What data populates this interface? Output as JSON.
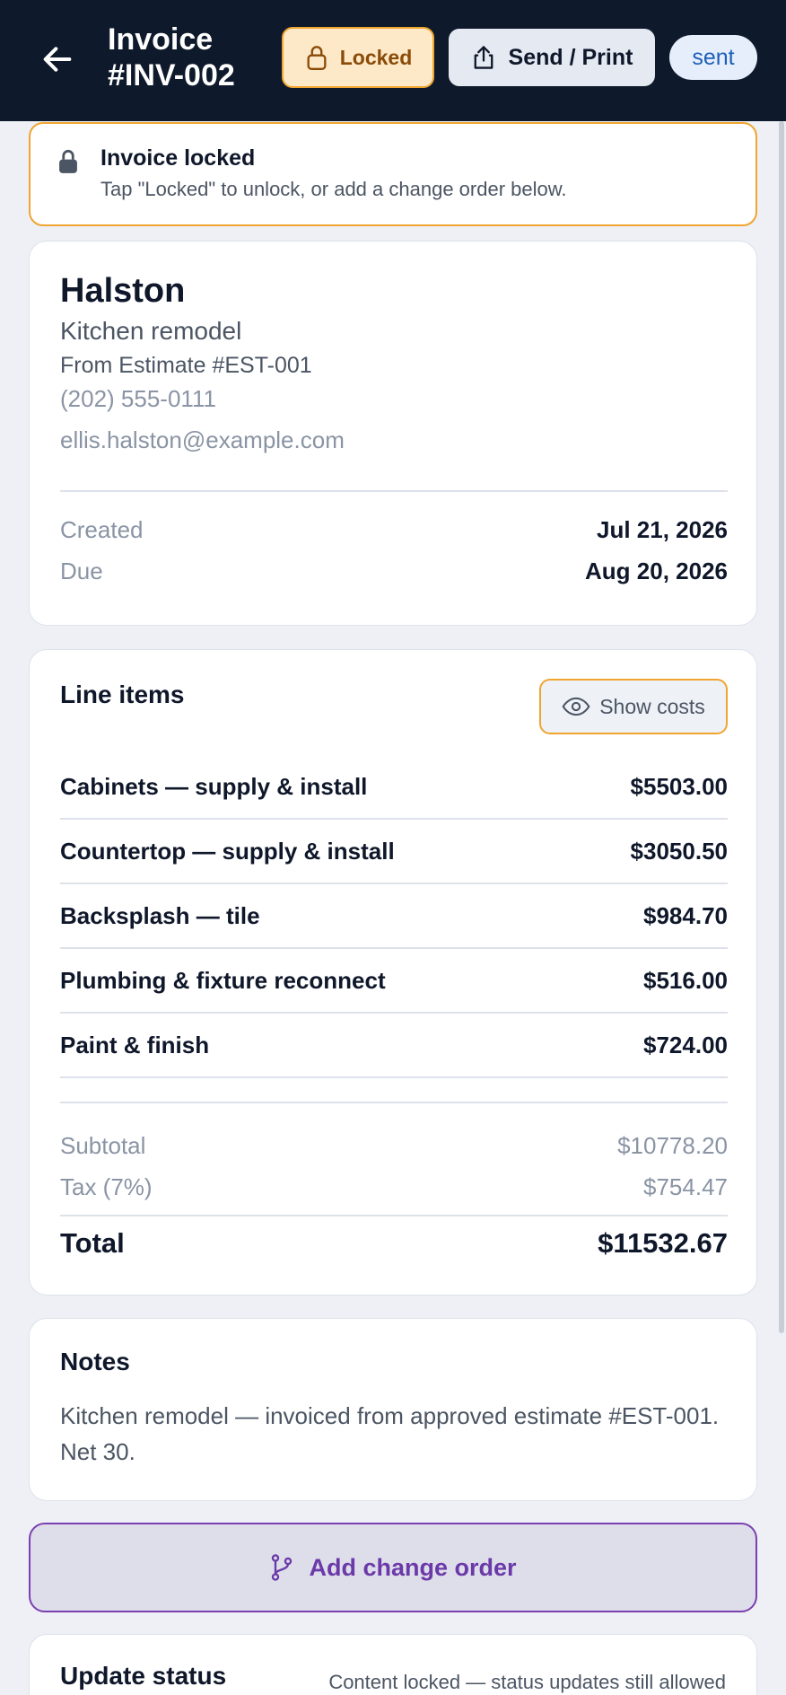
{
  "header": {
    "title_line1": "Invoice",
    "title_line2": "#INV-002",
    "locked_label": "Locked",
    "send_label": "Send / Print",
    "status": "sent"
  },
  "banner": {
    "title": "Invoice locked",
    "subtitle": "Tap \"Locked\" to unlock, or add a change order below."
  },
  "client": {
    "name": "Halston",
    "project": "Kitchen remodel",
    "from_estimate": "From Estimate #EST-001",
    "phone": "(202) 555-0111",
    "email": "ellis.halston@example.com",
    "created_label": "Created",
    "created_value": "Jul 21, 2026",
    "due_label": "Due",
    "due_value": "Aug 20, 2026"
  },
  "line_items": {
    "title": "Line items",
    "show_costs_label": "Show costs",
    "items": [
      {
        "name": "Cabinets — supply & install",
        "amount": "$5503.00"
      },
      {
        "name": "Countertop — supply & install",
        "amount": "$3050.50"
      },
      {
        "name": "Backsplash — tile",
        "amount": "$984.70"
      },
      {
        "name": "Plumbing & fixture reconnect",
        "amount": "$516.00"
      },
      {
        "name": "Paint & finish",
        "amount": "$724.00"
      }
    ],
    "subtotal_label": "Subtotal",
    "subtotal_value": "$10778.20",
    "tax_label": "Tax (7%)",
    "tax_value": "$754.47",
    "total_label": "Total",
    "total_value": "$11532.67"
  },
  "notes": {
    "title": "Notes",
    "body": "Kitchen remodel — invoiced from approved estimate #EST-001. Net 30."
  },
  "change_order": {
    "label": "Add change order"
  },
  "status_update": {
    "title": "Update status",
    "note": "Content locked — status updates still allowed"
  },
  "icons": {
    "back": "arrow-left-icon",
    "lock": "lock-icon",
    "share": "share-icon",
    "eye": "eye-icon",
    "branch": "git-branch-icon"
  },
  "colors": {
    "header_bg": "#0e1a2b",
    "accent_amber": "#f0a530",
    "purple": "#6b3aa8",
    "status_blue": "#1d5fb8"
  }
}
